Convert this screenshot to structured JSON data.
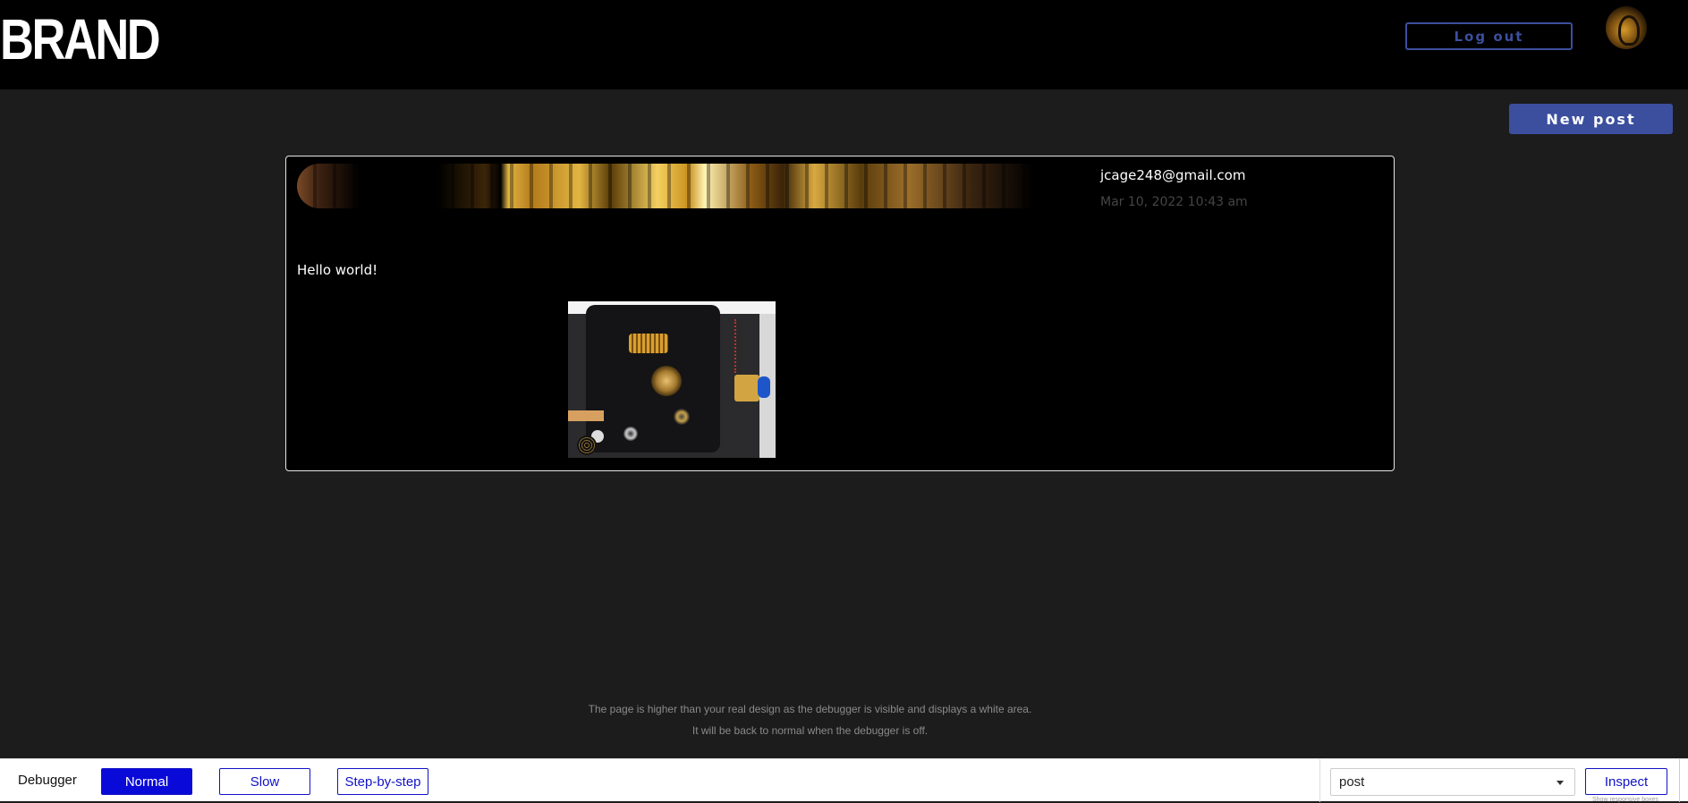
{
  "header": {
    "brand": "BRAND",
    "logout_label": "Log out",
    "avatar_icon": "avatar-icon"
  },
  "toolbar": {
    "new_post_label": "New post"
  },
  "post": {
    "author": "jcage248@gmail.com",
    "date": "Mar 10, 2022 10:43 am",
    "text": "Hello world!"
  },
  "debug_notes": {
    "line1": "The page is higher than your real design as the debugger is visible and displays a white area.",
    "line2": "It will be back to normal when the debugger is off."
  },
  "debugger": {
    "label": "Debugger",
    "modes": [
      "Normal",
      "Slow",
      "Step-by-step"
    ],
    "active_mode": "Normal",
    "selected": "post",
    "inspect_label": "Inspect",
    "responsive_note": "Show responsive boxes"
  },
  "colors": {
    "accent": "#3b4f9e",
    "debug_blue": "#0a0ad8",
    "background": "#1c1c1c"
  }
}
